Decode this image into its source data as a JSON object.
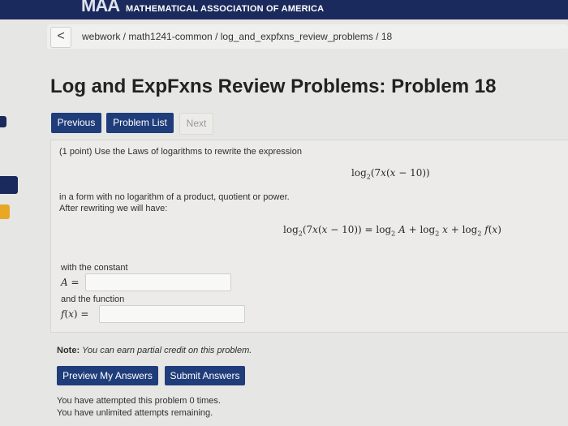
{
  "header": {
    "logo_text": "MAA",
    "org_name": "MATHEMATICAL ASSOCIATION OF AMERICA"
  },
  "breadcrumb": {
    "back_glyph": "<",
    "path": "webwork / math1241-common / log_and_expfxns_review_problems / 18"
  },
  "page": {
    "title": "Log and ExpFxns Review Problems: Problem 18"
  },
  "nav": {
    "previous": "Previous",
    "problem_list": "Problem List",
    "next": "Next"
  },
  "problem": {
    "intro": "(1 point) Use the Laws of logarithms to rewrite the expression",
    "instructions_1": "in a form with no logarithm of a product, quotient or power.",
    "instructions_2": "After rewriting we will have:",
    "constant_label": "with the constant",
    "function_label": "and the function",
    "constant_value": "",
    "function_value": ""
  },
  "note": {
    "label": "Note:",
    "text": "You can earn partial credit on this problem."
  },
  "actions": {
    "preview": "Preview My Answers",
    "submit": "Submit Answers"
  },
  "status": {
    "attempts": "You have attempted this problem 0 times.",
    "remaining": "You have unlimited attempts remaining."
  },
  "colors": {
    "header_bg": "#1b2a5c",
    "button_bg": "#1f3d7a"
  }
}
